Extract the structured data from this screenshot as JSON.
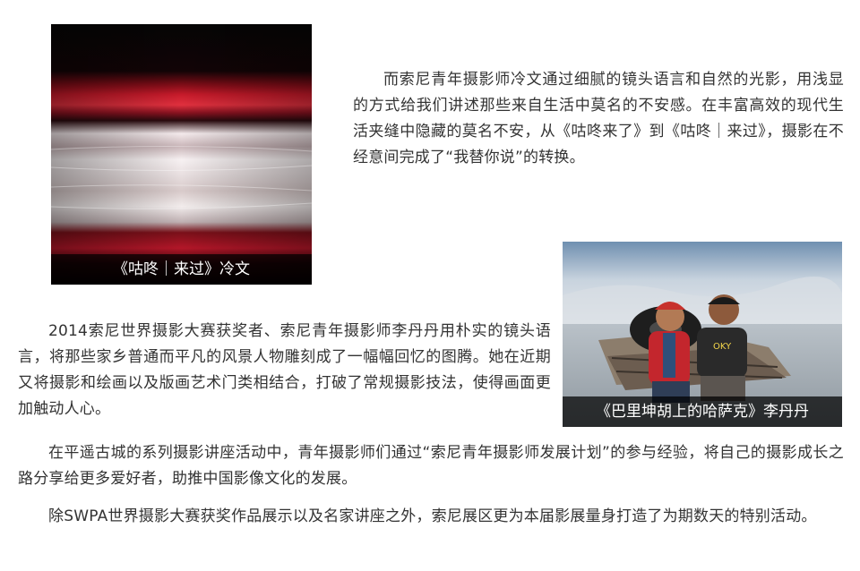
{
  "photo1": {
    "caption": "《咕咚｜来过》冷文"
  },
  "photo2": {
    "caption": "《巴里坤胡上的哈萨克》李丹丹"
  },
  "paragraphs": {
    "p1": "而索尼青年摄影师冷文通过细腻的镜头语言和自然的光影，用浅显的方式给我们讲述那些来自生活中莫名的不安感。在丰富高效的现代生活夹缝中隐藏的莫名不安，从《咕咚来了》到《咕咚｜来过》，摄影在不经意间完成了“我替你说”的转换。",
    "p2": "2014索尼世界摄影大赛获奖者、索尼青年摄影师李丹丹用朴实的镜头语言，将那些家乡普通而平凡的风景人物雕刻成了一幅幅回忆的图腾。她在近期又将摄影和绘画以及版画艺术门类相结合，打破了常规摄影技法，使得画面更加触动人心。",
    "p3": "在平遥古城的系列摄影讲座活动中，青年摄影师们通过“索尼青年摄影师发展计划”的参与经验，将自己的摄影成长之路分享给更多爱好者，助推中国影像文化的发展。",
    "p4": "除SWPA世界摄影大赛获奖作品展示以及名家讲座之外，索尼展区更为本届影展量身打造了为期数天的特别活动。"
  },
  "photo2_shirt_text": "OKY"
}
